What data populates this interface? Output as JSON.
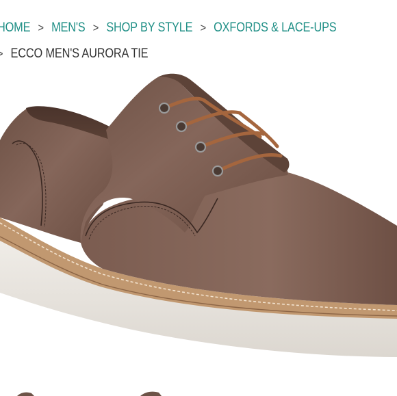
{
  "breadcrumb": {
    "items": [
      {
        "label": "HOME"
      },
      {
        "label": "MEN'S"
      },
      {
        "label": "SHOP BY STYLE"
      },
      {
        "label": "OXFORDS & LACE-UPS"
      }
    ],
    "separator": ">",
    "current": "ECCO MEN'S AURORA TIE"
  },
  "product_image": {
    "subject": "brown leather lace-up oxford shoe with white wedge sole"
  },
  "colors": {
    "link": "#1f8f86",
    "text": "#333333",
    "leather": "#7a5b4d",
    "sole": "#e9e5df",
    "welt": "#c49a72"
  }
}
